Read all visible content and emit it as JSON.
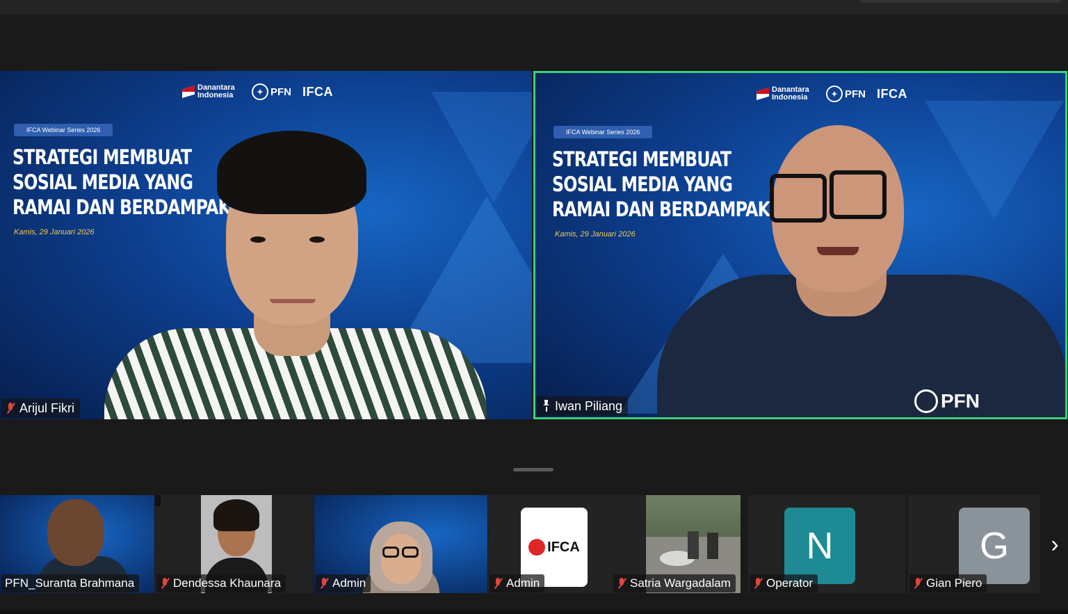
{
  "meeting": {
    "presentation": {
      "brand_danantara": "Danantara Indonesia",
      "brand_pfn": "PFN",
      "brand_ifca": "IFCA",
      "series": "IFCA Webinar Series 2026",
      "headline_lines": [
        "STRATEGI MEMBUAT",
        "SOSIAL MEDIA YANG",
        "RAMAI DAN BERDAMPAK"
      ],
      "date": "Kamis, 29 Januari 2026"
    },
    "main_tiles": [
      {
        "name": "Arijul Fikri",
        "muted": true,
        "active_speaker": false
      },
      {
        "name": "Iwan Piliang",
        "muted": false,
        "pinned": true,
        "active_speaker": true,
        "shirt_logo": "PFN"
      }
    ],
    "thumbnails": [
      {
        "name": "PFN_Suranta Brahmana",
        "muted": false
      },
      {
        "name": "Dendessa Khaunara",
        "muted": true
      },
      {
        "name": "Admin",
        "muted": true
      },
      {
        "name": "Admin",
        "muted": true,
        "avatar_text": "IFCA"
      },
      {
        "name": "Satria Wargadalam",
        "muted": true
      },
      {
        "name": "Operator",
        "muted": true,
        "avatar_letter": "N"
      },
      {
        "name": "Gian Piero",
        "muted": true,
        "avatar_letter": "G"
      }
    ],
    "navigation": {
      "next_glyph": "›"
    }
  },
  "colors": {
    "active_speaker_border": "#3ad17a",
    "muted_mic": "#e0473c",
    "avatar_n_bg": "#1e8a94",
    "avatar_g_bg": "#8b939a",
    "date_text": "#f2c94c"
  }
}
